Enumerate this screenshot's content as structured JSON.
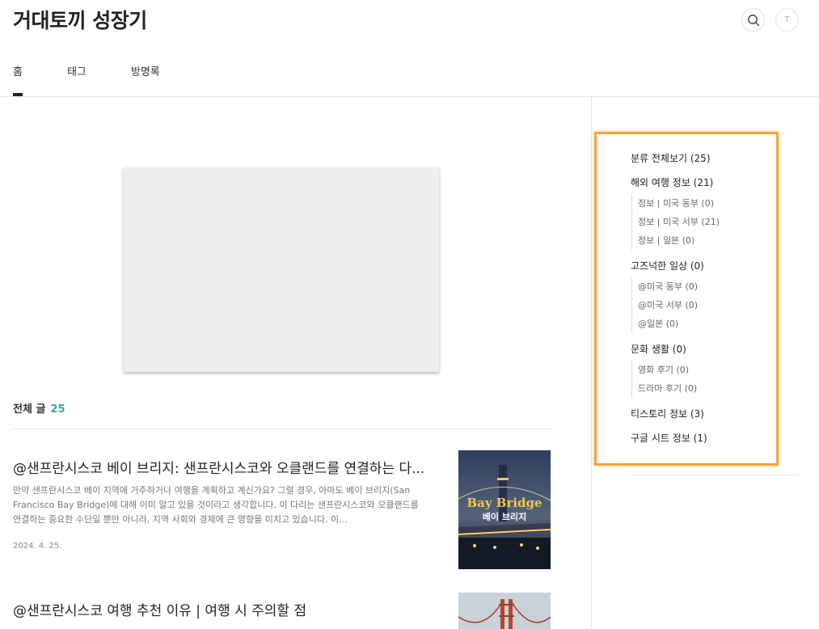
{
  "header": {
    "blog_title": "거대토끼 성장기",
    "profile_initial": "T"
  },
  "nav": {
    "items": [
      {
        "label": "홈",
        "active": true
      },
      {
        "label": "태그",
        "active": false
      },
      {
        "label": "방명록",
        "active": false
      }
    ]
  },
  "list": {
    "total_label": "전체 글",
    "total_count": "25"
  },
  "posts": [
    {
      "title": "@샌프란시스코 베이 브리지: 샌프란시스코와 오클랜드를 연결하는 다...",
      "excerpt": "만약 샌프란시스코 베이 지역에 거주하거나 여행을 계획하고 계신가요? 그럴 경우, 아마도 베이 브리지(San Francisco Bay Bridge)에 대해 이미 알고 있을 것이라고 생각합니다. 이 다리는 샌프란시스코와 오클랜드를 연결하는 중요한 수단일 뿐만 아니라, 지역 사회와 경제에 큰 영향을 미치고 있습니다. 이...",
      "date": "2024. 4. 25.",
      "thumb_text_en": "Bay Bridge",
      "thumb_text_ko": "베이 브리지"
    },
    {
      "title": "@샌프란시스코 여행 추천 이유 | 여행 시 주의할 점",
      "excerpt": ""
    }
  ],
  "categories": {
    "all": "분류 전체보기 (25)",
    "groups": [
      {
        "label": "해외 여행 정보 (21)",
        "subs": [
          "정보 | 미국 동부 (0)",
          "정보 | 미국 서부 (21)",
          "정보 | 일본 (0)"
        ]
      },
      {
        "label": "고즈넉한 일상 (0)",
        "subs": [
          "@미국 동부 (0)",
          "@미국 서부 (0)",
          "@일본 (0)"
        ]
      },
      {
        "label": "문화 생활 (0)",
        "subs": [
          "영화 후기 (0)",
          "드라마 후기 (0)"
        ]
      },
      {
        "label": "티스토리 정보 (3)",
        "subs": []
      },
      {
        "label": "구글 시트 정보 (1)",
        "subs": []
      }
    ]
  },
  "colors": {
    "accent_count": "#3aa8a0",
    "highlight_border": "#f0a640"
  }
}
